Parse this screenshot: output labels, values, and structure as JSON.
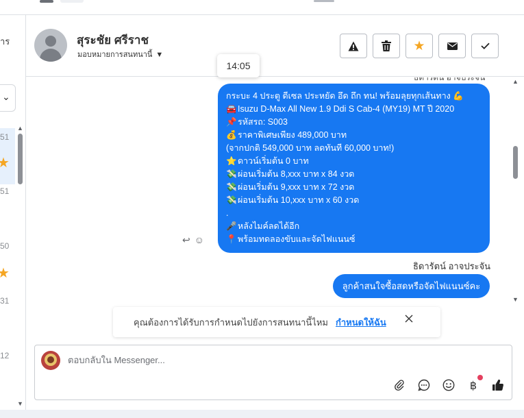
{
  "left_list": {
    "fragment_top": "าร",
    "selector_caret": "✓",
    "items": [
      {
        "num": "51",
        "starred": true
      },
      {
        "num": "51",
        "starred": false
      },
      {
        "num": "50",
        "starred": true
      },
      {
        "num": "31",
        "starred": false
      },
      {
        "num": "12",
        "starred": false
      }
    ]
  },
  "header": {
    "customer_name": "สุระชัย ศรีราช",
    "assign_label": "มอบหมายการสนทนานี้",
    "actions": [
      "report-spam",
      "delete",
      "star",
      "mark-unread",
      "mark-done"
    ]
  },
  "tooltip": {
    "time": "14:05"
  },
  "conversation": {
    "previous_sender_partial": "ธิดารัตน์ อาจประจัน",
    "customer_message_lines": [
      {
        "icon": "",
        "text": "กระบะ 4 ประตู ดีเซล ประหยัด อึด ถึก ทน! พร้อมลุยทุกเส้นทาง 💪"
      },
      {
        "icon": "🚘",
        "text": "Isuzu D-Max All New 1.9 Ddi S Cab-4 (MY19) MT ปี 2020"
      },
      {
        "icon": "📌",
        "text": "รหัสรถ: S003"
      },
      {
        "icon": "💰",
        "text": "ราคาพิเศษเพียง 489,000 บาท"
      },
      {
        "icon": "",
        "text": "(จากปกติ 549,000 บาท ลดทันที 60,000 บาท!)"
      },
      {
        "icon": "⭐",
        "text": "ดาวน์เริ่มต้น 0 บาท"
      },
      {
        "icon": "💸",
        "text": "ผ่อนเริ่มต้น 8,xxx บาท x 84 งวด"
      },
      {
        "icon": "💸",
        "text": "ผ่อนเริ่มต้น 9,xxx บาท x 72 งวด"
      },
      {
        "icon": "💸",
        "text": "ผ่อนเริ่มต้น 10,xxx บาท x 60 งวด"
      },
      {
        "icon": "",
        "text": "."
      },
      {
        "icon": "🎤",
        "text": "หลังไมค์ลดได้อีก"
      },
      {
        "icon": "📍",
        "text": "พร้อมทดลองขับและจัดไฟแนนซ์"
      }
    ],
    "agent_name": "ธิดารัตน์ อาจประจัน",
    "agent_reply": "ลูกค้าสนใจซื้อสดหรือจัดไฟแนนซ์คะ"
  },
  "notice": {
    "text": "คุณต้องการได้รับการกำหนดไปยังการสนทนานี้ไหม",
    "link": "กำหนดให้ฉัน"
  },
  "composer": {
    "placeholder": "ตอบกลับใน Messenger..."
  },
  "colors": {
    "accent": "#1778f2",
    "star": "#f5a623",
    "badge": "#e4405f"
  }
}
